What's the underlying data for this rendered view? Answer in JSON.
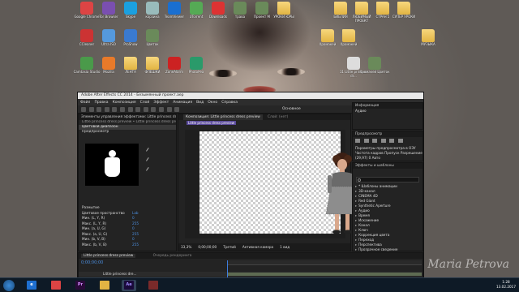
{
  "desktop": {
    "icons_top": [
      {
        "label": "Google Chrome",
        "icon": "chrome-icon"
      },
      {
        "label": "Tor Browser",
        "icon": "tor-icon"
      },
      {
        "label": "Skype",
        "icon": "skype-icon"
      },
      {
        "label": "корзина",
        "icon": "recycle-bin-icon"
      },
      {
        "label": "TeamViewer",
        "icon": "teamviewer-icon"
      },
      {
        "label": "UTorrent",
        "icon": "utorrent-icon"
      },
      {
        "label": "Downloads",
        "icon": "download-icon"
      },
      {
        "label": "трава",
        "icon": "image-file-icon"
      },
      {
        "label": "Проект М",
        "icon": "image-file-icon"
      },
      {
        "label": "УРОКИ ЮРЫ",
        "icon": "folder-icon"
      },
      {
        "label": "БИБЛИЯ",
        "icon": "folder-icon"
      },
      {
        "label": "ЛЮБИМЫЙ ПРОЕКТ",
        "icon": "folder-icon"
      },
      {
        "label": "CTPAH 5",
        "icon": "folder-icon"
      },
      {
        "label": "СУПЕР УРОКИ",
        "icon": "folder-icon"
      }
    ],
    "icons_row2": [
      {
        "label": "CCleaner",
        "icon": "ccleaner-icon"
      },
      {
        "label": "Ultra ISO",
        "icon": "disc-icon"
      },
      {
        "label": "ProShow",
        "icon": "proshow-icon"
      },
      {
        "label": "Цветок",
        "icon": "image-file-icon"
      },
      {
        "label": "Хромакей",
        "icon": "folder-icon"
      },
      {
        "label": "Хромакей",
        "icon": "folder-icon"
      },
      {
        "label": "МУЗЫКА",
        "icon": "folder-icon"
      }
    ],
    "icons_row3": [
      {
        "label": "Camtasia Studio",
        "icon": "camtasia-icon"
      },
      {
        "label": "Mozilla",
        "icon": "firefox-icon"
      },
      {
        "label": "ЛЕНТА",
        "icon": "folder-icon"
      },
      {
        "label": "ФЛЕШКИ",
        "icon": "folder-icon"
      },
      {
        "label": "ZoneAlarm",
        "icon": "zonealarm-icon"
      },
      {
        "label": "PhotoPea",
        "icon": "photopea-icon"
      },
      {
        "label": "11 Little princess dr...",
        "icon": "video-file-icon"
      },
      {
        "label": "Хромакей Цветок",
        "icon": "image-file-icon"
      }
    ],
    "watermark": "Maria Petrova"
  },
  "ae": {
    "title": "Adobe After Effects CC 2014 - Безымянный проект.aep",
    "menu": [
      "Файл",
      "Правка",
      "Композиция",
      "Слой",
      "Эффект",
      "Анимация",
      "Вид",
      "Окно",
      "Справка"
    ],
    "toolbar_right": {
      "workspace": "Основное",
      "search": "Поиск в справке"
    },
    "effects_panel": {
      "tab": "Элементы управления эффектами: Little princess dr...",
      "crumb": "Little princess dress preview • Little princess dress preview.mp4",
      "effect_name": "Цветовой диапазон",
      "preview_label": "Предпросмотр",
      "props": [
        {
          "label": "Размытие",
          "value": ""
        },
        {
          "label": "Цветовое пространство",
          "value": "Lab"
        },
        {
          "label": "Мин. (L, Y, R)",
          "value": "0"
        },
        {
          "label": "Макс. (L, Y, R)",
          "value": "255"
        },
        {
          "label": "Мин. (a, U, G)",
          "value": "0"
        },
        {
          "label": "Макс. (a, U, G)",
          "value": "255"
        },
        {
          "label": "Мин. (b, V, B)",
          "value": "0"
        },
        {
          "label": "Макс. (b, V, B)",
          "value": "255"
        }
      ]
    },
    "comp_panel": {
      "tab_active": "Композиция: Little princess dress preview",
      "tab_2": "Слой: (нет)",
      "crumb": "Little princess dress preview",
      "bottom": [
        "33,3%",
        "0;00;00;00",
        "Третий",
        "Активная камера",
        "1 вид"
      ]
    },
    "info_panel": {
      "tab": "Информация",
      "rows": [
        "Аудио"
      ]
    },
    "preview_panel": {
      "tab": "Предпросмотр",
      "rows": [
        "Параметры предпросмотра в ОЗУ",
        "Частота кадров  Пропуск  Разрешение",
        "(29,97)  0  Авто"
      ]
    },
    "presets_panel": {
      "tab": "Эффекты и шаблоны",
      "search_placeholder": "",
      "items": [
        "* Шаблоны анимации",
        "3D-канал",
        "CINEMA 4D",
        "Red Giant",
        "Synthetic Aperture",
        "Аудио",
        "Время",
        "Искажение",
        "Канал",
        "Ключ",
        "Коррекция цвета",
        "Переход",
        "Перспектива",
        "Прозрачное сведение"
      ]
    },
    "timeline": {
      "tab_active": "Little princess dress preview",
      "tab_2": "Очередь рендеринга",
      "time": "0;00;00;00",
      "layer_name": "Little princess dre..."
    }
  },
  "taskbar": {
    "apps": [
      "Internet Explorer",
      "Chrome",
      "Pr",
      "Explorer",
      "Ae",
      "Media"
    ],
    "clock_time": "1:28",
    "clock_date": "13.02.2017"
  }
}
